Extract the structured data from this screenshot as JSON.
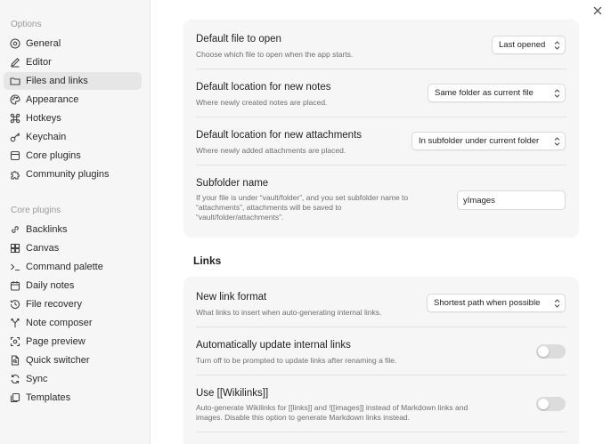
{
  "sidebar": {
    "options_title": "Options",
    "options_items": [
      {
        "label": "General",
        "icon": "settings-circle-icon"
      },
      {
        "label": "Editor",
        "icon": "pencil-icon"
      },
      {
        "label": "Files and links",
        "icon": "folder-icon"
      },
      {
        "label": "Appearance",
        "icon": "palette-icon"
      },
      {
        "label": "Hotkeys",
        "icon": "command-icon"
      },
      {
        "label": "Keychain",
        "icon": "key-icon"
      },
      {
        "label": "Core plugins",
        "icon": "plug-icon"
      },
      {
        "label": "Community plugins",
        "icon": "puzzle-icon"
      }
    ],
    "active_item": "Files and links",
    "core_title": "Core plugins",
    "core_items": [
      {
        "label": "Backlinks",
        "icon": "backlinks-icon"
      },
      {
        "label": "Canvas",
        "icon": "canvas-icon"
      },
      {
        "label": "Command palette",
        "icon": "terminal-icon"
      },
      {
        "label": "Daily notes",
        "icon": "calendar-icon"
      },
      {
        "label": "File recovery",
        "icon": "history-icon"
      },
      {
        "label": "Note composer",
        "icon": "merge-icon"
      },
      {
        "label": "Page preview",
        "icon": "preview-icon"
      },
      {
        "label": "Quick switcher",
        "icon": "file-search-icon"
      },
      {
        "label": "Sync",
        "icon": "sync-icon"
      },
      {
        "label": "Templates",
        "icon": "templates-icon"
      }
    ]
  },
  "settings": {
    "default_file": {
      "name": "Default file to open",
      "desc": "Choose which file to open when the app starts.",
      "value": "Last opened"
    },
    "new_notes_location": {
      "name": "Default location for new notes",
      "desc": "Where newly created notes are placed.",
      "value": "Same folder as current file"
    },
    "attachments_location": {
      "name": "Default location for new attachments",
      "desc": "Where newly added attachments are placed.",
      "value": "In subfolder under current folder"
    },
    "subfolder_name": {
      "name": "Subfolder name",
      "desc_line1": "If your file is under “vault/folder”, and you set subfolder name to",
      "desc_line2": "“attachments”, attachments will be saved to",
      "desc_line3": "“vault/folder/attachments”.",
      "value": "yImages"
    }
  },
  "links": {
    "heading": "Links",
    "new_link_format": {
      "name": "New link format",
      "desc": "What links to insert when auto-generating internal links.",
      "value": "Shortest path when possible"
    },
    "auto_update": {
      "name": "Automatically update internal links",
      "desc": "Turn off to be prompted to update links after renaming a file.",
      "enabled": false
    },
    "wikilinks": {
      "name": "Use [[Wikilinks]]",
      "desc_line1": "Auto-generate Wikilinks for [[links]] and ![[images]] instead of Markdown links and",
      "desc_line2": "images. Disable this option to generate Markdown links instead.",
      "enabled": false
    }
  },
  "colors": {
    "sidebar_bg": "#f6f6f6",
    "active_bg": "#e6e6e6",
    "card_bg": "#f6f6f6",
    "toggle_off": "#dcdcdc"
  }
}
